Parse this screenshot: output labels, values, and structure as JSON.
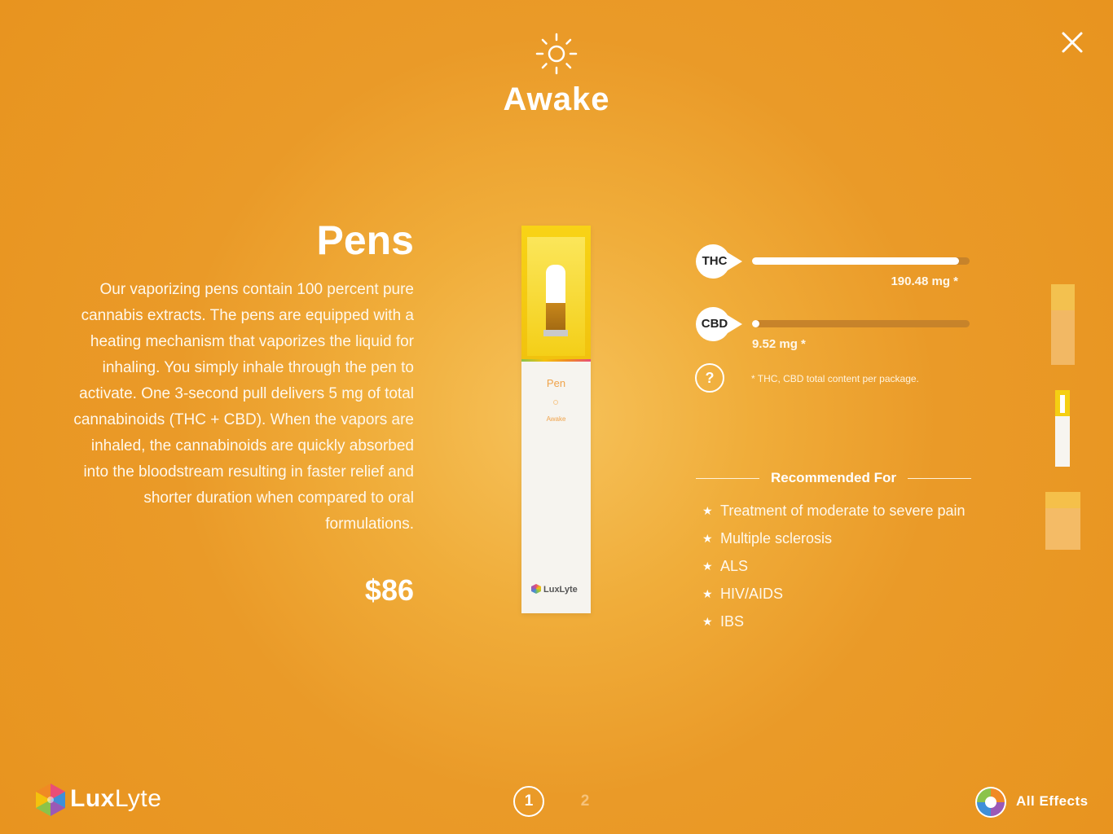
{
  "header": {
    "effect_icon": "sun-icon",
    "effect_title": "Awake",
    "close_icon": "close-icon"
  },
  "product": {
    "title": "Pens",
    "description": "Our vaporizing pens contain 100 percent pure cannabis extracts. The pens are equipped with a heating mechanism that vaporizes the liquid for inhaling. You simply inhale through the pen to activate. One 3-second pull delivers 5 mg of total cannabinoids (THC + CBD). When the vapors are inhaled, the cannabinoids are quickly absorbed into the bloodstream resulting in faster relief and shorter duration when compared to oral formulations.",
    "price": "$86",
    "package": {
      "type_label": "Pen",
      "effect_label": "Awake",
      "brand": "LuxLyte"
    }
  },
  "cannabinoids": {
    "thc": {
      "label": "THC",
      "value_text": "190.48 mg *",
      "fill_fraction": 0.95
    },
    "cbd": {
      "label": "CBD",
      "value_text": "9.52 mg *",
      "fill_fraction": 0.03
    },
    "help_label": "?",
    "footnote": "* THC, CBD total content per package."
  },
  "recommended": {
    "title": "Recommended For",
    "items": [
      "Treatment of moderate to severe pain",
      "Multiple sclerosis",
      "ALS",
      "HIV/AIDS",
      "IBS"
    ]
  },
  "footer": {
    "brand_bold": "Lux",
    "brand_light": "Lyte",
    "pages": [
      "1",
      "2"
    ],
    "current_page": "1",
    "all_effects_label": "All Effects"
  },
  "colors": {
    "background": "#ea9a28",
    "bar_track": "#c7832a",
    "bar_fill": "#ffffff"
  }
}
